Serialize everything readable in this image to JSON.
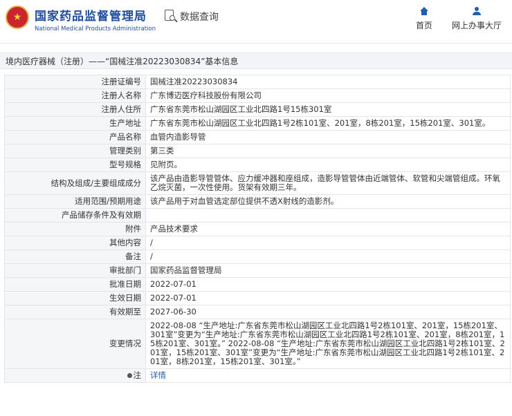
{
  "header": {
    "site_name": "国家药品监督管理局",
    "site_name_en": "National Medical Products Administration",
    "query_label": "数据查询",
    "nav": [
      {
        "label": "首页",
        "icon": "home-icon"
      },
      {
        "label": "网上办事大厅",
        "icon": "user-icon"
      }
    ]
  },
  "breadcrumb": "境内医疗器械（注册）——“国械注准20223030834”基本信息",
  "rows": [
    {
      "key": "注册证编号",
      "value": "国械注准20223030834"
    },
    {
      "key": "注册人名称",
      "value": "广东博迈医疗科技股份有限公司"
    },
    {
      "key": "注册人住所",
      "value": "广东省东莞市松山湖园区工业北四路1号15栋301室"
    },
    {
      "key": "生产地址",
      "value": "广东省东莞市松山湖园区工业北四路1号2栋101室、201室，8栋201室，15栋201室、301室。"
    },
    {
      "key": "产品名称",
      "value": "血管内造影导管"
    },
    {
      "key": "管理类别",
      "value": "第三类"
    },
    {
      "key": "型号规格",
      "value": "见附页。"
    },
    {
      "key": "结构及组成/主要组成成分",
      "value": "该产品由造影导管管体、应力缓冲器和座组成，造影导管管体由近端管体、软管和尖端管组成。环氧乙烷灭菌，一次性使用。货架有效期三年。"
    },
    {
      "key": "适用范围/预期用途",
      "value": "该产品用于对血管选定部位提供不透X射线的造影剂。"
    },
    {
      "key": "产品储存条件及有效期",
      "value": ""
    },
    {
      "key": "附件",
      "value": "产品技术要求"
    },
    {
      "key": "其他内容",
      "value": "/"
    },
    {
      "key": "备注",
      "value": "/"
    },
    {
      "key": "审批部门",
      "value": "国家药品监督管理局"
    },
    {
      "key": "批准日期",
      "value": "2022-07-01"
    },
    {
      "key": "生效日期",
      "value": "2022-07-01"
    },
    {
      "key": "有效期至",
      "value": "2027-06-30"
    },
    {
      "key": "变更情况",
      "value": "2022-08-08 “生产地址:广东省东莞市松山湖园区工业北四路1号2栋101室、201室，15栋201室、301室”变更为“生产地址:广东省东莞市松山湖园区工业北四路1号2栋101室、201室，8栋201室，15栋201室、301室。” 2022-08-08 “生产地址:广东省东莞市松山湖园区工业北四路1号2栋101室、201室，15栋201室、301室”变更为“生产地址:广东省东莞市松山湖园区工业北四路1号2栋101室、201室，8栋201室，15栋201室、301室。”"
    }
  ],
  "note": {
    "key": "注",
    "value": "详情"
  }
}
